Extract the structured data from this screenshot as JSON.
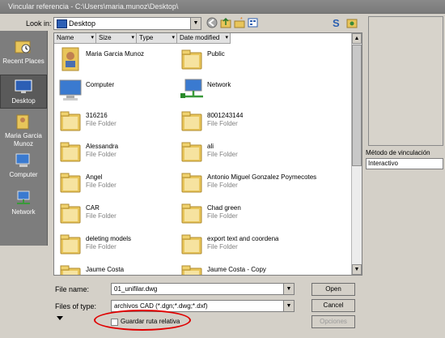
{
  "window": {
    "title": "Vincular referencia - C:\\Users\\maria.munoz\\Desktop\\"
  },
  "toolbar": {
    "look_in_label": "Look in:",
    "look_in_value": "Desktop"
  },
  "places": [
    {
      "label": "Recent Places",
      "icon": "recent-places-icon"
    },
    {
      "label": "Desktop",
      "icon": "desktop-icon"
    },
    {
      "label": "Maria Garcia Munoz",
      "icon": "user-folder-icon"
    },
    {
      "label": "Computer",
      "icon": "computer-icon"
    },
    {
      "label": "Network",
      "icon": "network-icon"
    }
  ],
  "columns": [
    "Name",
    "Size",
    "Type",
    "Date modified"
  ],
  "items": [
    {
      "name": "Maria Garcia Munoz",
      "type": "",
      "icon": "user-folder-icon"
    },
    {
      "name": "Public",
      "type": "",
      "icon": "folder-icon"
    },
    {
      "name": "Computer",
      "type": "",
      "icon": "computer-icon"
    },
    {
      "name": "Network",
      "type": "",
      "icon": "network-icon"
    },
    {
      "name": "316216",
      "type": "File Folder",
      "icon": "folder-icon"
    },
    {
      "name": "8001243144",
      "type": "File Folder",
      "icon": "folder-icon"
    },
    {
      "name": "Alessandra",
      "type": "File Folder",
      "icon": "folder-icon"
    },
    {
      "name": "ali",
      "type": "File Folder",
      "icon": "folder-icon"
    },
    {
      "name": "Angel",
      "type": "File Folder",
      "icon": "folder-icon"
    },
    {
      "name": "Antonio Miguel Gonzalez Poymecotes",
      "type": "File Folder",
      "icon": "folder-icon"
    },
    {
      "name": "CAR",
      "type": "File Folder",
      "icon": "folder-icon"
    },
    {
      "name": "Chad green",
      "type": "File Folder",
      "icon": "folder-icon"
    },
    {
      "name": "deleting models",
      "type": "File Folder",
      "icon": "folder-icon"
    },
    {
      "name": "export text and coordena",
      "type": "File Folder",
      "icon": "folder-icon"
    },
    {
      "name": "Jaume Costa",
      "type": "",
      "icon": "folder-icon"
    },
    {
      "name": "Jaume Costa - Copy",
      "type": "",
      "icon": "folder-icon"
    }
  ],
  "footer": {
    "file_name_label": "File name:",
    "file_name_value": "01_unifilar.dwg",
    "file_type_label": "Files of type:",
    "file_type_value": "archivos CAD (*.dgn;*.dwg;*.dxf)",
    "open_label": "Open",
    "cancel_label": "Cancel",
    "options_label": "Opciones",
    "relative_path_label": "Guardar ruta relativa"
  },
  "link_method": {
    "label": "Método de vinculación",
    "value": "Interactivo"
  },
  "colors": {
    "titlebar": "#808080",
    "places_bg": "#7d7d7d",
    "annotation": "#e00000",
    "folder": "#e8c55a"
  }
}
